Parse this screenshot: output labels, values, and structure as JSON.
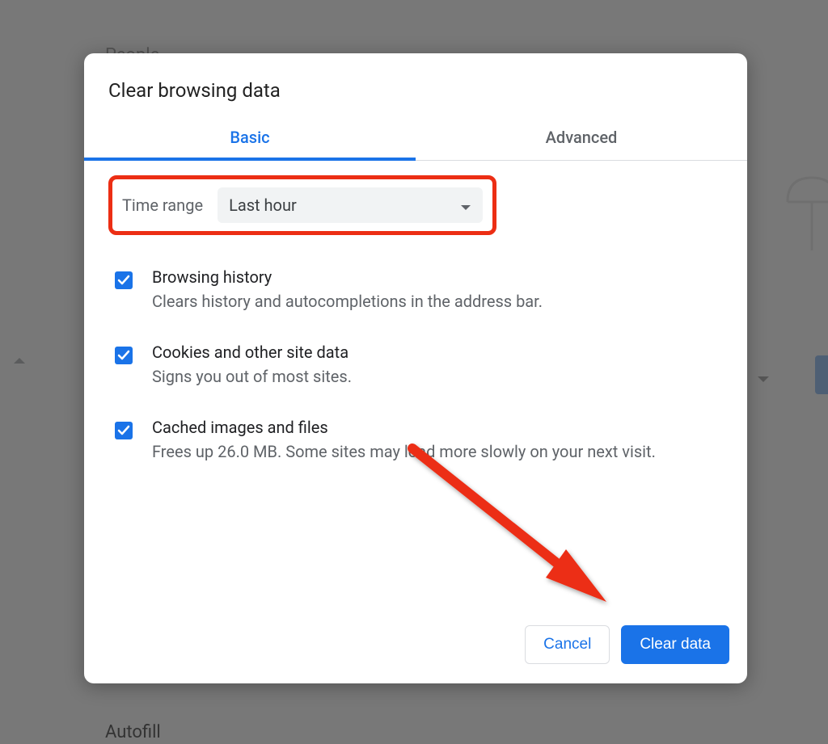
{
  "background": {
    "section_people": "People",
    "section_autofill": "Autofill"
  },
  "dialog": {
    "title": "Clear browsing data",
    "tabs": {
      "basic": "Basic",
      "advanced": "Advanced"
    },
    "time_range": {
      "label": "Time range",
      "value": "Last hour"
    },
    "options": [
      {
        "title": "Browsing history",
        "desc": "Clears history and autocompletions in the address bar."
      },
      {
        "title": "Cookies and other site data",
        "desc": "Signs you out of most sites."
      },
      {
        "title": "Cached images and files",
        "desc": "Frees up 26.0 MB. Some sites may load more slowly on your next visit."
      }
    ],
    "buttons": {
      "cancel": "Cancel",
      "clear": "Clear data"
    }
  },
  "annotations": {
    "highlight_color": "#ec2e14"
  }
}
